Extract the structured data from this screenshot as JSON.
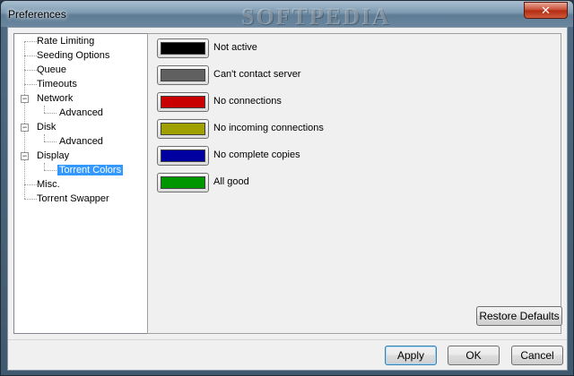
{
  "window": {
    "title": "Preferences",
    "watermark": "SOFTPEDIA",
    "close_glyph": "✕"
  },
  "tree": {
    "items": [
      {
        "label": "Rate Limiting"
      },
      {
        "label": "Seeding Options"
      },
      {
        "label": "Queue"
      },
      {
        "label": "Timeouts"
      },
      {
        "label": "Network"
      },
      {
        "label": "Advanced"
      },
      {
        "label": "Disk"
      },
      {
        "label": "Advanced"
      },
      {
        "label": "Display"
      },
      {
        "label": "Torrent Colors"
      },
      {
        "label": "Misc."
      },
      {
        "label": "Torrent Swapper"
      }
    ],
    "collapse_glyph": "−"
  },
  "colors": [
    {
      "label": "Not active",
      "color": "#000000"
    },
    {
      "label": "Can't contact server",
      "color": "#606060"
    },
    {
      "label": "No connections",
      "color": "#c80000"
    },
    {
      "label": "No incoming connections",
      "color": "#a0a000"
    },
    {
      "label": "No complete copies",
      "color": "#0000a0"
    },
    {
      "label": "All good",
      "color": "#009600"
    }
  ],
  "buttons": {
    "restore_defaults": "Restore Defaults",
    "apply": "Apply",
    "ok": "OK",
    "cancel": "Cancel"
  }
}
